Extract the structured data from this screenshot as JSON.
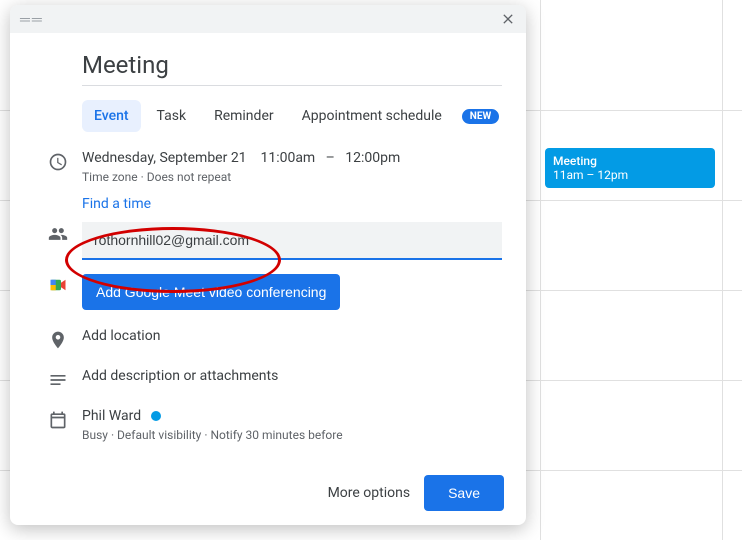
{
  "calendar": {
    "event_title": "Meeting",
    "event_time": "11am – 12pm"
  },
  "dialog": {
    "title": "Meeting",
    "tabs": {
      "event": "Event",
      "task": "Task",
      "reminder": "Reminder",
      "appointment": "Appointment schedule",
      "new_badge": "NEW"
    },
    "time": {
      "date": "Wednesday, September 21",
      "start": "11:00am",
      "dash": "–",
      "end": "12:00pm",
      "sub": "Time zone · Does not repeat",
      "find": "Find a time"
    },
    "guests": {
      "value": "rothornhill02@gmail.com"
    },
    "meet_button": "Add Google Meet video conferencing",
    "location_placeholder": "Add location",
    "description_placeholder": "Add description or attachments",
    "organizer": {
      "name": "Phil Ward",
      "sub": "Busy · Default visibility · Notify 30 minutes before"
    },
    "footer": {
      "more": "More options",
      "save": "Save"
    }
  }
}
